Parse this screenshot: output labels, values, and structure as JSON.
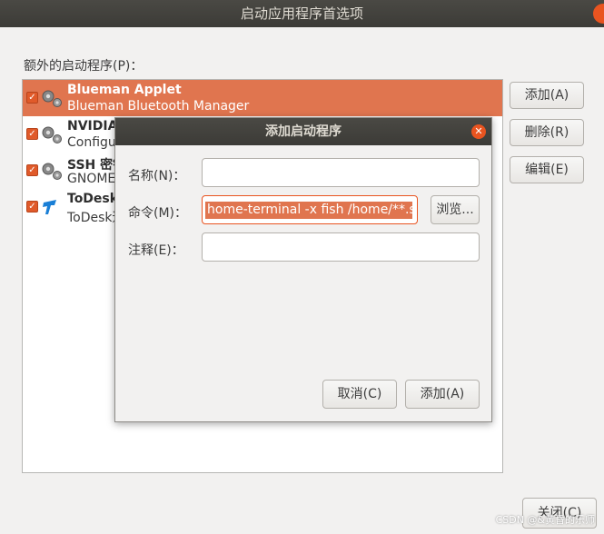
{
  "window": {
    "title": "启动应用程序首选项"
  },
  "main": {
    "list_label": "额外的启动程序(P)：",
    "items": [
      {
        "title": "Blueman Applet",
        "subtitle": "Blueman Bluetooth Manager",
        "checked": true,
        "selected": true,
        "icon": "gears-icon"
      },
      {
        "title": "NVIDIA",
        "subtitle": "Configur",
        "checked": true,
        "selected": false,
        "icon": "gears-icon"
      },
      {
        "title": "SSH 密钥",
        "subtitle": "GNOME",
        "checked": true,
        "selected": false,
        "icon": "gears-icon"
      },
      {
        "title": "ToDesk",
        "subtitle": "ToDesk远",
        "checked": true,
        "selected": false,
        "icon": "todesk-icon"
      }
    ],
    "buttons": {
      "add": "添加(A)",
      "remove": "删除(R)",
      "edit": "编辑(E)",
      "close": "关闭(C)"
    }
  },
  "dialog": {
    "title": "添加启动程序",
    "name_label": "名称(N)：",
    "name_value": "",
    "command_label": "命令(M)：",
    "command_value": "home-terminal -x fish /home/**.sh",
    "comment_label": "注释(E)：",
    "comment_value": "",
    "browse": "浏览...",
    "cancel": "取消(C)",
    "add": "添加(A)"
  },
  "watermark": "CSDN @&黄昏的乐师",
  "colors": {
    "accent": "#e95420",
    "selection": "#e0754f",
    "titlebar": "#3c3b37"
  }
}
